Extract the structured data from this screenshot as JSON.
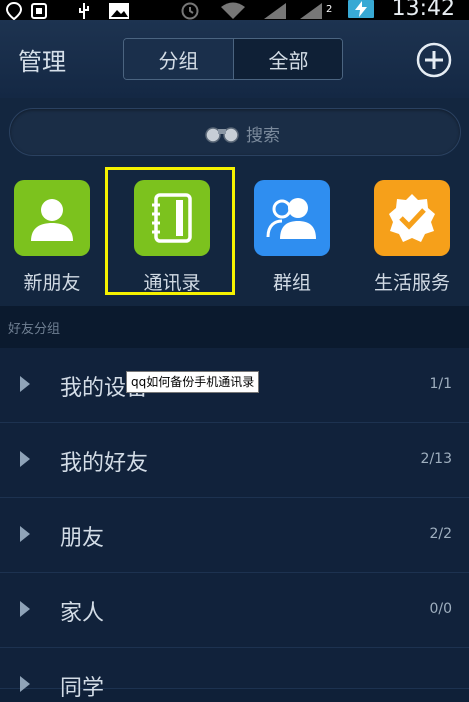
{
  "status_bar": {
    "sim_slot": "2",
    "time": "13:42"
  },
  "header": {
    "title": "管理",
    "tabs": [
      {
        "label": "分组",
        "selected": true
      },
      {
        "label": "全部",
        "selected": false
      }
    ]
  },
  "search": {
    "placeholder": "搜索"
  },
  "quick_entries": [
    {
      "label": "新朋友",
      "icon": "person-icon",
      "color": "#7cc21e"
    },
    {
      "label": "通讯录",
      "icon": "address-book-icon",
      "color": "#7cc21e",
      "highlighted": true
    },
    {
      "label": "群组",
      "icon": "group-icon",
      "color": "#2f8ef0"
    },
    {
      "label": "生活服务",
      "icon": "verified-badge-icon",
      "color": "#f6a01a"
    }
  ],
  "section": {
    "title": "好友分组"
  },
  "groups": [
    {
      "name": "我的设备",
      "count": "1/1"
    },
    {
      "name": "我的好友",
      "count": "2/13"
    },
    {
      "name": "朋友",
      "count": "2/2"
    },
    {
      "name": "家人",
      "count": "0/0"
    },
    {
      "name": "同学",
      "count": ""
    }
  ],
  "tooltip": {
    "text": "qq如何备份手机通讯录"
  }
}
